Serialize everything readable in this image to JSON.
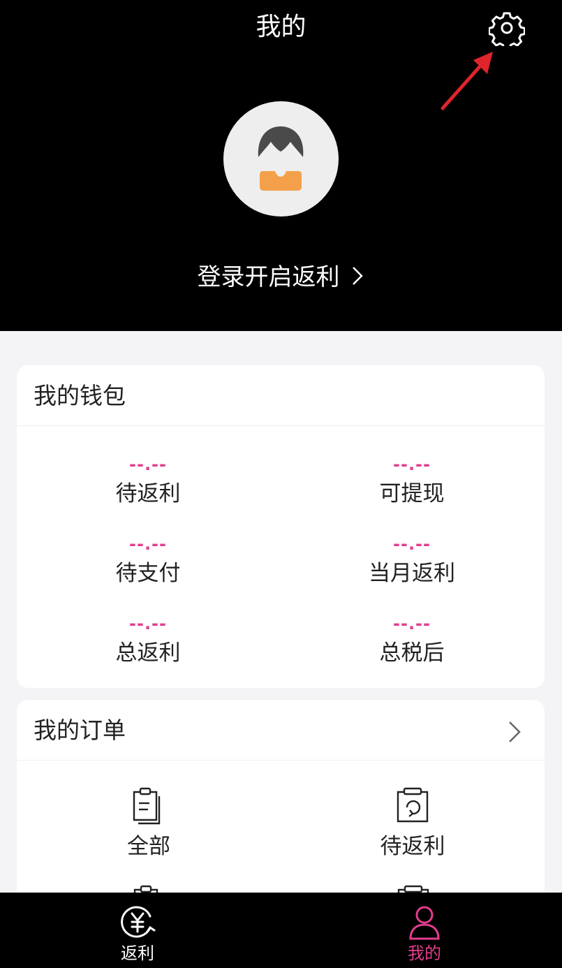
{
  "header": {
    "title": "我的",
    "login_text": "登录开启返利"
  },
  "wallet": {
    "title": "我的钱包",
    "stats": [
      {
        "value": "--.--",
        "label": "待返利"
      },
      {
        "value": "--.--",
        "label": "可提现"
      },
      {
        "value": "--.--",
        "label": "待支付"
      },
      {
        "value": "--.--",
        "label": "当月返利"
      },
      {
        "value": "--.--",
        "label": "总返利"
      },
      {
        "value": "--.--",
        "label": "总税后"
      }
    ]
  },
  "orders": {
    "title": "我的订单",
    "items": [
      {
        "label": "全部",
        "icon": "clipboard-list-icon"
      },
      {
        "label": "待返利",
        "icon": "clipboard-refresh-icon"
      }
    ]
  },
  "tabbar": {
    "tabs": [
      {
        "label": "返利",
        "icon": "yen-refresh-icon",
        "active": false
      },
      {
        "label": "我的",
        "icon": "user-icon",
        "active": true
      }
    ]
  },
  "colors": {
    "accent": "#e23d8d",
    "header_bg": "#000000",
    "page_bg": "#f4f4f6",
    "annotation_arrow": "#e0242b",
    "avatar_shirt": "#f4a04a"
  }
}
